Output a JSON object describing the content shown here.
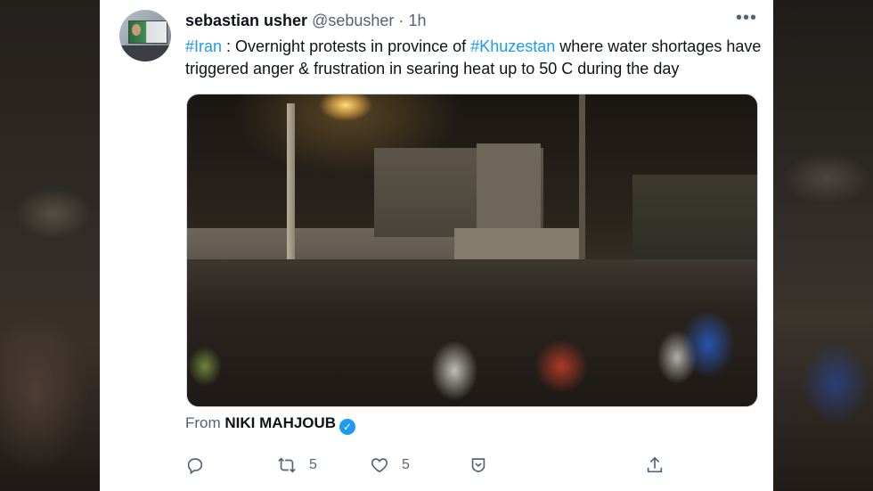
{
  "tweet": {
    "author_name": "sebastian usher",
    "author_handle": "@sebusher",
    "separator": "·",
    "time": "1h",
    "text_parts": [
      {
        "text": "#Iran",
        "hashtag": true
      },
      {
        "text": " : Overnight protests in province of ",
        "hashtag": false
      },
      {
        "text": "#Khuzestan",
        "hashtag": true
      },
      {
        "text": " where water shortages have triggered anger & frustration in searing heat up to 50 C during the day",
        "hashtag": false
      }
    ],
    "media_from_label": "From",
    "media_source": "NIKI MAHJOUB"
  },
  "actions": {
    "reply_count": "",
    "retweet_count": "5",
    "like_count": "5"
  },
  "icons": {
    "more": "more-horizontal-icon",
    "reply": "reply-icon",
    "retweet": "retweet-icon",
    "like": "heart-icon",
    "bookmark": "bookmark-icon",
    "share": "share-icon",
    "verified": "verified-badge-icon"
  },
  "colors": {
    "link": "#1d9bf0",
    "text": "#0f1419",
    "secondary": "#536471"
  }
}
